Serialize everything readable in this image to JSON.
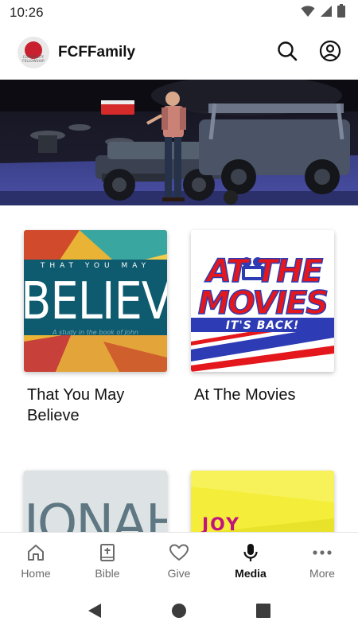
{
  "status_bar": {
    "time": "10:26",
    "icons": [
      "wifi-icon",
      "cellular-signal-icon",
      "battery-icon"
    ]
  },
  "header": {
    "logo_text": "faith",
    "logo_subtext": "COMMUNITY FELLOWSHIP",
    "title": "FCFFamily",
    "icons": [
      "search-icon",
      "account-icon"
    ]
  },
  "hero": {
    "description": "featured-video-banner"
  },
  "series": [
    {
      "title": "That You May Believe",
      "art": {
        "top_text": "THAT YOU MAY",
        "big_text": "BELIEVE",
        "sub_text": "A study in the book of John"
      }
    },
    {
      "title": "At The Movies",
      "art": {
        "line1": "AT THE",
        "line2": "MOVIES",
        "line3": "IT'S BACK!"
      }
    },
    {
      "title": "",
      "art": {
        "big_text": "JONAH"
      }
    },
    {
      "title": "",
      "art": {
        "big_text": "JOY"
      }
    }
  ],
  "bottom_nav": {
    "items": [
      {
        "label": "Home",
        "icon": "home-icon",
        "active": false
      },
      {
        "label": "Bible",
        "icon": "bible-icon",
        "active": false
      },
      {
        "label": "Give",
        "icon": "heart-icon",
        "active": false
      },
      {
        "label": "Media",
        "icon": "microphone-icon",
        "active": true
      },
      {
        "label": "More",
        "icon": "more-icon",
        "active": false
      }
    ]
  },
  "system_nav": [
    "back-icon",
    "home-circle-icon",
    "recents-icon"
  ],
  "colors": {
    "brand_red": "#c8202e",
    "active_nav": "#111111",
    "inactive_nav": "#6b6b6b",
    "believe_teal": "#0e5a6e",
    "movies_blue": "#2d3bb4",
    "movies_red": "#e3171c",
    "joy_yellow": "#f4ee3a"
  }
}
